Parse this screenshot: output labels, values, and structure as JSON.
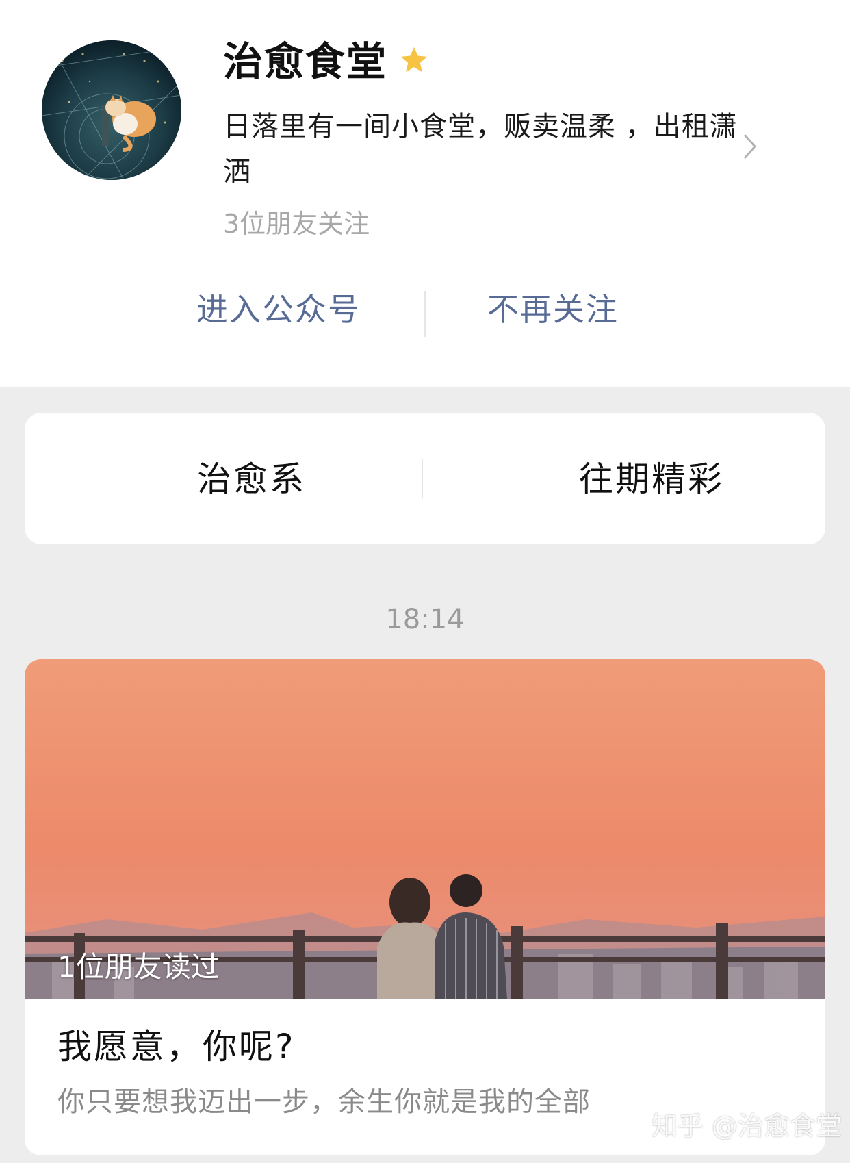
{
  "profile": {
    "name": "治愈食堂",
    "description": "日落里有一间小食堂，贩卖温柔 ，出租潇洒",
    "followers": "3位朋友关注",
    "icons": {
      "star": "star-icon",
      "chevron": "chevron-right-icon"
    },
    "star_color": "#f6c343"
  },
  "actions": {
    "enter_label": "进入公众号",
    "unfollow_label": "不再关注",
    "link_color": "#576b95"
  },
  "menu": {
    "items": [
      {
        "label": "治愈系"
      },
      {
        "label": "往期精彩"
      }
    ]
  },
  "feed": {
    "timestamp": "18:14",
    "article": {
      "read_badge": "1位朋友读过",
      "title": "我愿意，你呢?",
      "summary": "你只要想我迈出一步，余生你就是我的全部"
    }
  },
  "watermark": "知乎 @治愈食堂"
}
